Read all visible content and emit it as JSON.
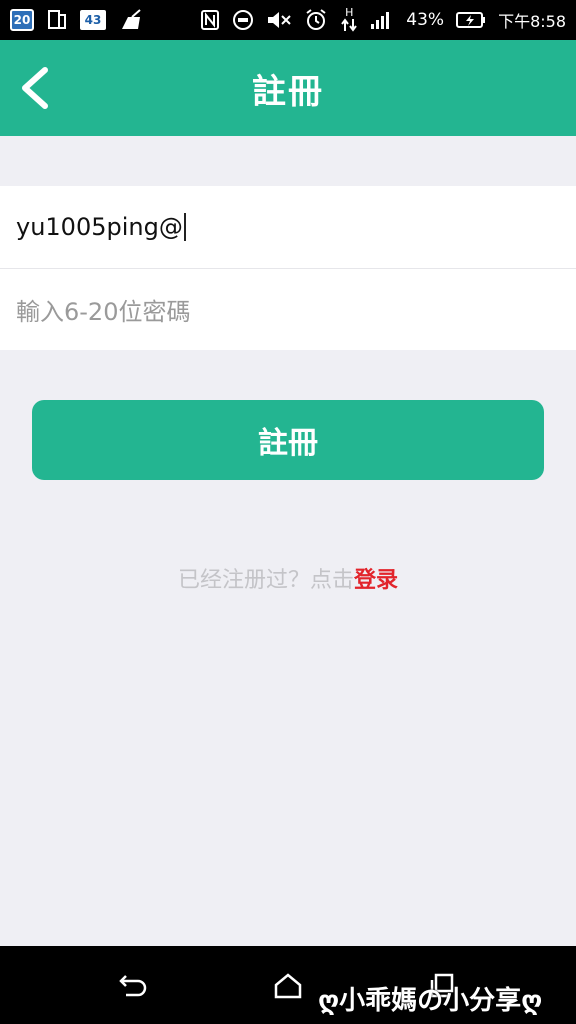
{
  "status_bar": {
    "calendar_day": "20",
    "notification_count": "43",
    "battery_percent": "43%",
    "time": "下午8:58",
    "network_label": "H"
  },
  "header": {
    "title": "註冊"
  },
  "form": {
    "account_value": "yu1005ping@",
    "password_placeholder": "輸入6-20位密碼"
  },
  "register_button": {
    "label": "註冊"
  },
  "login_hint": {
    "prefix": "已经注册过？点击",
    "link": "登录"
  },
  "watermark": {
    "text": "ღ小乖媽の小分享ღ"
  },
  "colors": {
    "accent": "#23b591",
    "link": "#e2242b",
    "background": "#efeff4"
  }
}
